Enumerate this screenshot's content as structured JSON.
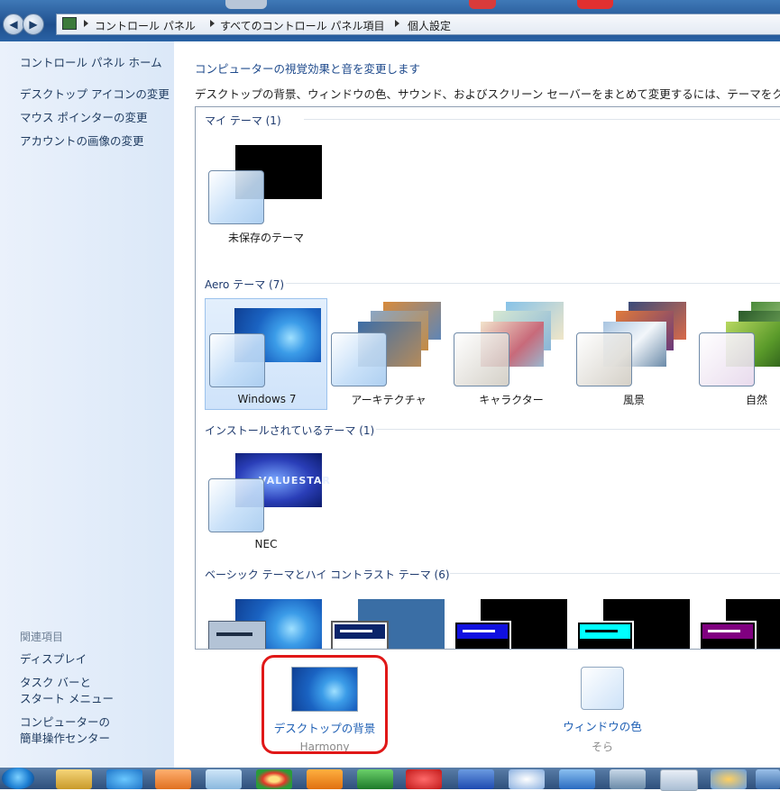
{
  "breadcrumb": [
    "コントロール パネル",
    "すべてのコントロール パネル項目",
    "個人設定"
  ],
  "sidebar": {
    "home": "コントロール パネル ホーム",
    "links": [
      "デスクトップ アイコンの変更",
      "マウス ポインターの変更",
      "アカウントの画像の変更"
    ],
    "related_heading": "関連項目",
    "related": [
      "ディスプレイ",
      "タスク バーと",
      "スタート メニュー",
      "コンピューターの",
      "簡単操作センター"
    ]
  },
  "main": {
    "title": "コンピューターの視覚効果と音を変更します",
    "description": "デスクトップの背景、ウィンドウの色、サウンド、およびスクリーン セーバーをまとめて変更するには、テーマをクリッ",
    "sections": [
      {
        "name": "マイ テーマ (1)",
        "themes": [
          "未保存のテーマ"
        ]
      },
      {
        "name": "Aero テーマ (7)",
        "themes": [
          "Windows 7",
          "アーキテクチャ",
          "キャラクター",
          "風景",
          "自然"
        ]
      },
      {
        "name": "インストールされているテーマ (1)",
        "themes": [
          "NEC"
        ]
      },
      {
        "name": "ベーシック テーマとハイ コントラスト テーマ (6)",
        "themes": []
      }
    ],
    "nec_logo_text": "VALUESTAR"
  },
  "bottom": {
    "background": {
      "label": "デスクトップの背景",
      "value": "Harmony"
    },
    "color": {
      "label": "ウィンドウの色",
      "value": "そら"
    }
  },
  "colors": {
    "accent": "#1e5fb4",
    "highlight": "#e01818"
  }
}
